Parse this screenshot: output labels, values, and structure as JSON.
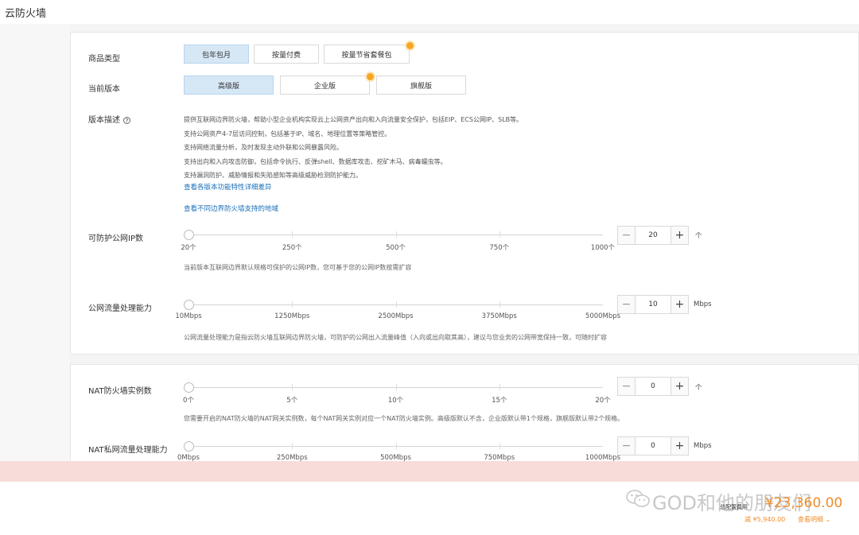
{
  "header": {
    "title": "云防火墙"
  },
  "product_type": {
    "label": "商品类型",
    "options": [
      "包年包月",
      "按量付费",
      "按量节省套餐包"
    ],
    "selected": "包年包月"
  },
  "edition": {
    "label": "当前版本",
    "options": [
      "高级版",
      "企业版",
      "旗舰版"
    ],
    "selected": "高级版"
  },
  "description": {
    "label": "版本描述",
    "help_icon": "?",
    "lines": [
      "提供互联网边界防火墙，帮助小型企业机构实现云上公网资产出向和入向流量安全保护，包括EIP、ECS公网IP、SLB等。",
      "支持公网资产4-7层访问控制，包括基于IP、域名、地理位置等策略管控。",
      "支持网络流量分析，及时发现主动外联和公网暴露风险。",
      "支持出向和入向攻击防御，包括命令执行、反弹shell、数据库攻击、挖矿木马、病毒蠕虫等。",
      "支持漏洞防护、威胁情报和失陷感知等高级威胁检测防护能力。"
    ],
    "link_features": "查看各版本功能特性详细差异",
    "link_regions": "查看不同边界防火墙支持的地域"
  },
  "public_ip": {
    "label": "可防护公网IP数",
    "ticks": [
      "20个",
      "250个",
      "500个",
      "750个",
      "1000个"
    ],
    "value": "20",
    "unit": "个",
    "note": "当前版本互联网边界默认规格可保护的公网IP数，您可基于您的公网IP数按需扩容",
    "slider_level": 0
  },
  "public_bandwidth": {
    "label": "公网流量处理能力",
    "ticks": [
      "10Mbps",
      "1250Mbps",
      "2500Mbps",
      "3750Mbps",
      "5000Mbps"
    ],
    "value": "10",
    "unit": "Mbps",
    "note": "公网流量处理能力是指云防火墙互联网边界防火墙，可防护的公网出入流量峰值（入向或出向取其高），建议与您业务的公网带宽保持一致，可随时扩容",
    "slider_level": 0
  },
  "nat_instances": {
    "label": "NAT防火墙实例数",
    "ticks": [
      "0个",
      "5个",
      "10个",
      "15个",
      "20个"
    ],
    "value": "0",
    "unit": "个",
    "note": "您需要开启的NAT防火墙的NAT网关实例数，每个NAT网关实例对应一个NAT防火墙实例。高级版默认不含，企业版默认带1个规格，旗舰版默认带2个规格。",
    "slider_level": 0
  },
  "nat_bandwidth": {
    "label": "NAT私网流量处理能力",
    "ticks": [
      "0Mbps",
      "250Mbps",
      "500Mbps",
      "750Mbps",
      "1000Mbps"
    ],
    "value": "0",
    "unit": "Mbps",
    "slider_level": 0
  },
  "footer": {
    "watermark": "GOD和他的朋友们",
    "total_label": "总配置费用",
    "total_price": "¥23,360.00",
    "discount": "减 ¥5,940.00",
    "detail_link": "查看明细"
  },
  "colors": {
    "active_option": "#d6e7f6",
    "link": "#1a6fb8",
    "price": "#f08c2a",
    "badge": "#f5a623",
    "pink_bar": "#f7dcd9"
  }
}
